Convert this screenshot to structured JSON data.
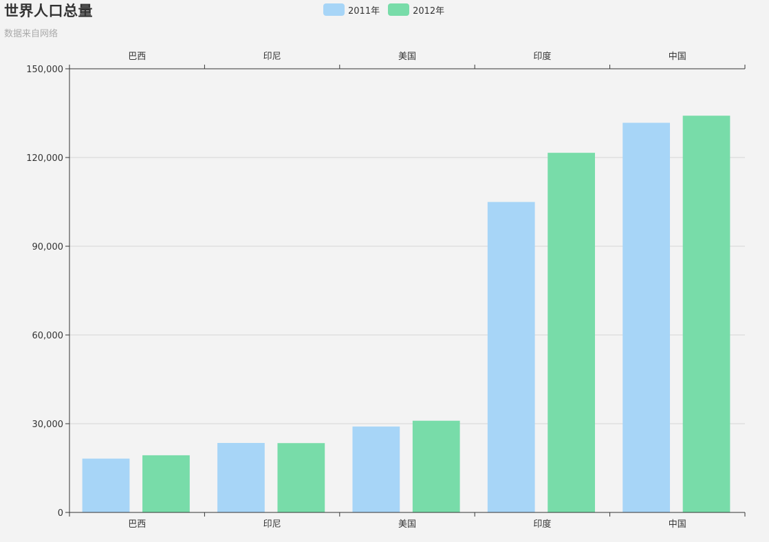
{
  "title": "世界人口总量",
  "subtitle": "数据来自网络",
  "colors": {
    "series_2011": "#a7d5f7",
    "series_2012": "#78dca9",
    "axis": "#333333",
    "grid": "#d6d6d6",
    "background": "#f3f3f3"
  },
  "chart_data": {
    "type": "bar",
    "title": "世界人口总量",
    "subtitle": "数据来自网络",
    "categories": [
      "巴西",
      "印尼",
      "美国",
      "印度",
      "中国"
    ],
    "series": [
      {
        "name": "2011年",
        "values": [
          18203,
          23489,
          29034,
          104970,
          131744
        ]
      },
      {
        "name": "2012年",
        "values": [
          19325,
          23438,
          31000,
          121594,
          134141
        ]
      }
    ],
    "ylim": [
      0,
      150000
    ],
    "yticks": [
      0,
      30000,
      60000,
      90000,
      120000,
      150000
    ],
    "ytick_labels": [
      "0",
      "30,000",
      "60,000",
      "90,000",
      "120,000",
      "150,000"
    ],
    "grid": true,
    "legend_position": "top-center",
    "xaxis_top_labels": true
  }
}
